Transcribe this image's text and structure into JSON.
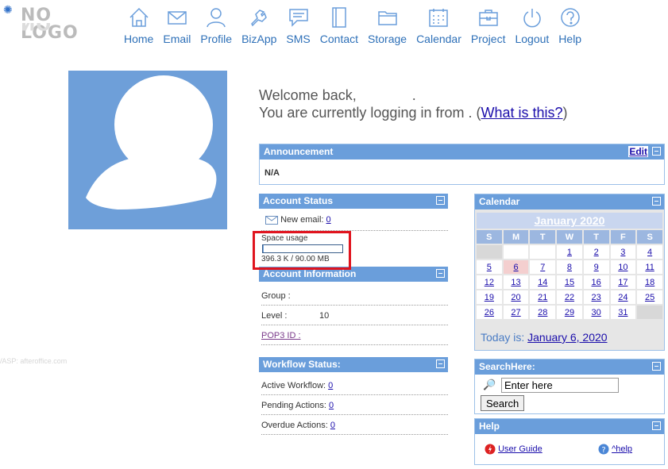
{
  "logo": {
    "text": "NO LOGO"
  },
  "nav": [
    {
      "label": "Home",
      "icon": "home-icon"
    },
    {
      "label": "Email",
      "icon": "email-icon"
    },
    {
      "label": "Profile",
      "icon": "profile-icon"
    },
    {
      "label": "BizApp",
      "icon": "bizapp-icon"
    },
    {
      "label": "SMS",
      "icon": "sms-icon"
    },
    {
      "label": "Contact",
      "icon": "contact-icon"
    },
    {
      "label": "Storage",
      "icon": "storage-icon"
    },
    {
      "label": "Calendar",
      "icon": "calendar-icon"
    },
    {
      "label": "Project",
      "icon": "project-icon"
    },
    {
      "label": "Logout",
      "icon": "logout-icon"
    },
    {
      "label": "Help",
      "icon": "help-icon"
    }
  ],
  "welcome": {
    "line1": "Welcome back,",
    "line1_suffix": ".",
    "line2_prefix": "You are currently logging in from . (",
    "what_link": "What is this?",
    "line2_suffix": ")"
  },
  "watermark": "VASP: afteroffice.com",
  "announcement": {
    "title": "Announcement",
    "edit": "Edit",
    "body": "N/A"
  },
  "account_status": {
    "title": "Account Status",
    "new_email_label": "New email:",
    "new_email_count": "0",
    "space_label": "Space usage",
    "space_value": "396.3 K / 90.00 MB",
    "space_fraction": 0.0043
  },
  "account_info": {
    "title": "Account Information",
    "group_label": "Group :",
    "group_value": "",
    "level_label": "Level :",
    "level_value": "10",
    "pop3_label": "POP3 ID :"
  },
  "workflow": {
    "title": "Workflow Status:",
    "active_label": "Active Workflow:",
    "active_value": "0",
    "pending_label": "Pending Actions:",
    "pending_value": "0",
    "overdue_label": "Overdue Actions:",
    "overdue_value": "0"
  },
  "calendar": {
    "title": "Calendar",
    "month": "January 2020",
    "weekdays": [
      "S",
      "M",
      "T",
      "W",
      "T",
      "F",
      "S"
    ],
    "weeks": [
      [
        "",
        "",
        "",
        "1",
        "2",
        "3",
        "4"
      ],
      [
        "5",
        "6",
        "7",
        "8",
        "9",
        "10",
        "11"
      ],
      [
        "12",
        "13",
        "14",
        "15",
        "16",
        "17",
        "18"
      ],
      [
        "19",
        "20",
        "21",
        "22",
        "23",
        "24",
        "25"
      ],
      [
        "26",
        "27",
        "28",
        "29",
        "30",
        "31",
        ""
      ]
    ],
    "today_day": "6",
    "today_prefix": "Today is: ",
    "today_link": "January 6, 2020"
  },
  "search": {
    "title": "SearchHere:",
    "placeholder": "Enter here",
    "button": "Search"
  },
  "help": {
    "title": "Help",
    "guide": "User Guide",
    "help": "^help"
  },
  "colors": {
    "header": "#6a9edb",
    "highlight": "#e0141e",
    "link": "#1a0dab"
  }
}
